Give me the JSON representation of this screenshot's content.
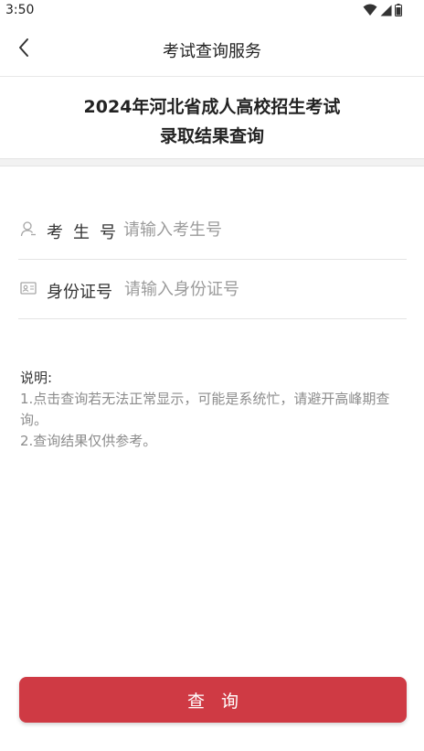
{
  "status_bar": {
    "time": "3:50"
  },
  "nav": {
    "title": "考试查询服务"
  },
  "header": {
    "title_line1": "2024年河北省成人高校招生考试",
    "title_line2": "录取结果查询"
  },
  "form": {
    "exam_number": {
      "label": "考生号",
      "placeholder": "请输入考生号",
      "value": ""
    },
    "id_number": {
      "label": "身份证号",
      "placeholder": "请输入身份证号",
      "value": ""
    }
  },
  "notes": {
    "title": "说明:",
    "items": [
      "1.点击查询若无法正常显示，可能是系统忙，请避开高峰期查询。",
      "2.查询结果仅供参考。"
    ]
  },
  "actions": {
    "query_label": "查询"
  },
  "colors": {
    "accent": "#cf3a44"
  },
  "icons": [
    "back-arrow-icon",
    "wifi-icon",
    "signal-icon",
    "battery-icon",
    "user-icon",
    "id-card-icon"
  ]
}
